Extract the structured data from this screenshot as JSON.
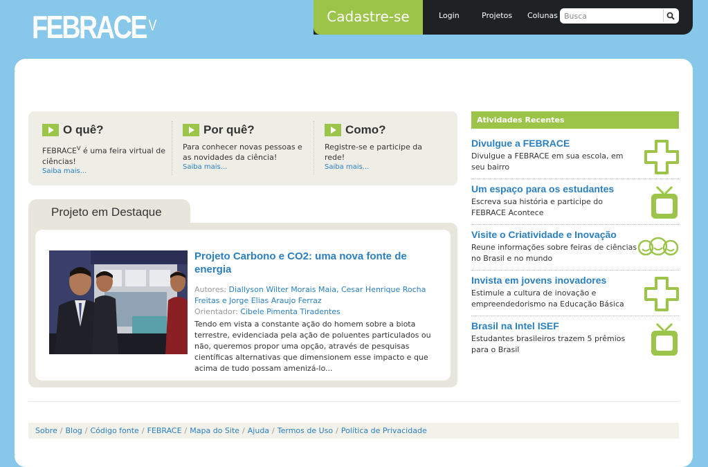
{
  "brand": {
    "logo_text": "FEBRACE",
    "logo_sup": "V"
  },
  "nav": {
    "cadastre": "Cadastre-se",
    "login": "Login",
    "projetos": "Projetos",
    "colunas": "Colunas",
    "search_placeholder": "Busca"
  },
  "intro": [
    {
      "title": "O quê?",
      "text_main": "FEBRACE",
      "text_sup": "V",
      "text_rest": " é uma feira virtual de ciências!",
      "more": "Saiba mais..."
    },
    {
      "title": "Por quê?",
      "text": "Para conhecer novas pessoas e as novidades da ciência!",
      "more": "Saiba mais..."
    },
    {
      "title": "Como?",
      "text": "Registre-se e participe da rede!",
      "more": "Saiba mais..."
    }
  ],
  "featured": {
    "tab": "Projeto em Destaque",
    "title": "Projeto Carbono e CO2: uma nova fonte de energia",
    "authors_label": "Autores:",
    "authors": "Diallyson Wilter Morais Maia, Cesar Henrique Rocha Freitas e Jorge Elias Araujo Ferraz",
    "advisor_label": "Orientador:",
    "advisor": "Cibele Pimenta Tiradentes",
    "description": "Tendo em vista a constante ação do homem sobre a biota terrestre, evidenciada pela ação de poluentes particulados ou não, queremos propor uma opção, através de pesquisas científicas alternativas que dimensionem esse impacto e que acima de tudo possam amenizá-lo..."
  },
  "activities": {
    "header": "Atividades Recentes",
    "items": [
      {
        "title": "Divulgue a FEBRACE",
        "desc": "Divulgue a FEBRACE em sua escola, em seu bairro",
        "icon": "plus-icon"
      },
      {
        "title": "Um espaço para os estudantes",
        "desc": "Escreva sua história e participe do FEBRACE Acontece",
        "icon": "tv-icon"
      },
      {
        "title": "Visite o Criatividade e Inovação",
        "desc": "Reune informações sobre feiras de ciências no Brasil e no mundo",
        "icon": "faces-icon"
      },
      {
        "title": "Invista em jovens inovadores",
        "desc": "Estimule a cultura de inovação e empreendedorismo na Educação Básica",
        "icon": "plus-icon"
      },
      {
        "title": "Brasil na Intel ISEF",
        "desc": "Estudantes brasileiros trazem 5 prêmios para o Brasil",
        "icon": "tv-icon"
      }
    ]
  },
  "footer": {
    "links": [
      "Sobre",
      "Blog",
      "Código fonte",
      "FEBRACE",
      "Mapa do Site",
      "Ajuda",
      "Termos de Uso",
      "Política de Privacidade"
    ],
    "separator": "/"
  },
  "colors": {
    "background": "#86c7ea",
    "accent_green": "#9bc449",
    "link_blue": "#2a7fc0",
    "topbar": "#1f2224"
  }
}
